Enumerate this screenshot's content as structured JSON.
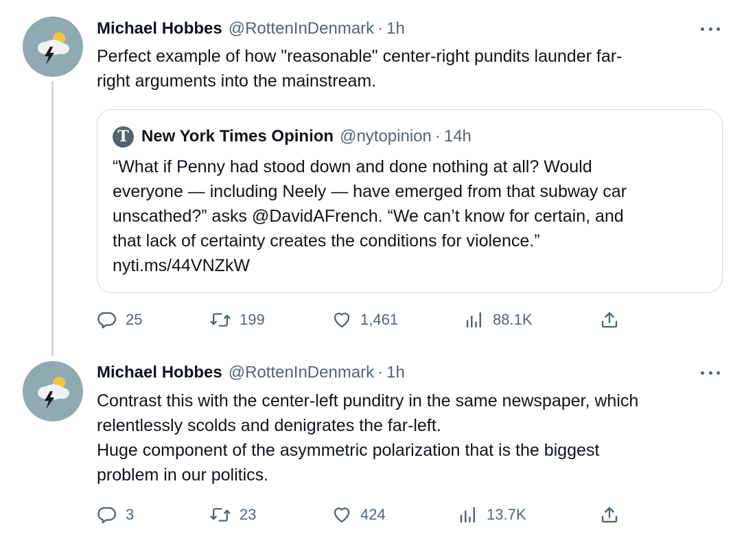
{
  "tweets": [
    {
      "author_name": "Michael Hobbes",
      "author_handle": "@RottenInDenmark",
      "separator": "·",
      "time": "1h",
      "text_lines": [
        "Perfect example of how \"reasonable\" center-right pundits launder far-",
        "right arguments into the mainstream."
      ],
      "quote": {
        "logo_glyph": "T",
        "author_name": "New York Times Opinion",
        "author_handle": "@nytopinion",
        "separator": "·",
        "time": "14h",
        "text_lines": [
          "“What if Penny had stood down and done nothing at all? Would",
          "everyone — including Neely — have emerged from that subway car",
          "unscathed?” asks @DavidAFrench. “We can’t know for certain, and",
          "that lack of certainty creates the conditions for violence.”",
          "nyti.ms/44VNZkW"
        ]
      },
      "stats": {
        "replies": "25",
        "retweets": "199",
        "likes": "1,461",
        "views": "88.1K"
      }
    },
    {
      "author_name": "Michael Hobbes",
      "author_handle": "@RottenInDenmark",
      "separator": "·",
      "time": "1h",
      "text_lines": [
        "Contrast this with the center-left punditry in the same newspaper, which",
        "relentlessly scolds and denigrates the far-left.",
        "Huge component of the asymmetric polarization that is the biggest",
        "problem in our politics."
      ],
      "stats": {
        "replies": "3",
        "retweets": "23",
        "likes": "424",
        "views": "13.7K"
      }
    }
  ],
  "icons": {
    "reply": "reply-icon",
    "retweet": "retweet-icon",
    "like": "heart-icon",
    "views": "views-icon",
    "share": "share-icon",
    "more": "more-icon",
    "avatar": "storm-cloud-avatar"
  },
  "colors": {
    "text_primary": "#0f1419",
    "text_secondary": "#536471",
    "border": "#cfd9de",
    "avatar_bg": "#8faab0"
  }
}
